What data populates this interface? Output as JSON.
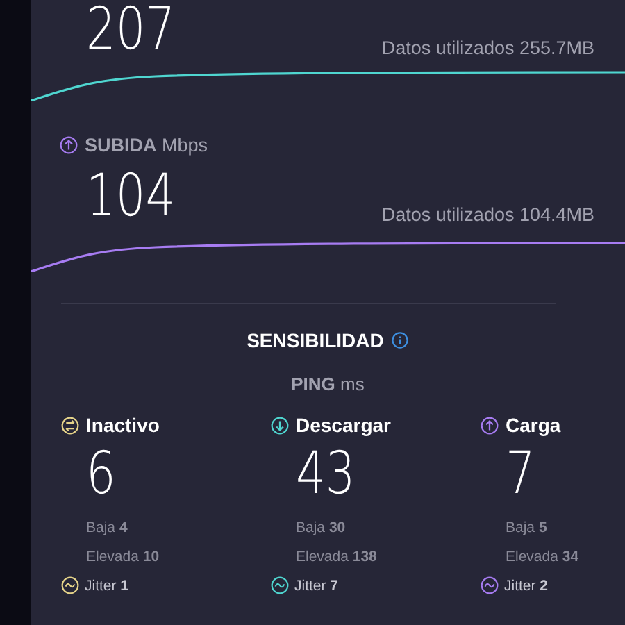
{
  "download": {
    "value": "207",
    "data_used": "Datos utilizados 255.7MB"
  },
  "upload": {
    "label": "**SUBIDA** Mbps",
    "value": "104",
    "data_used": "Datos utilizados 104.4MB"
  },
  "responsiveness": {
    "title": "SENSIBILIDAD",
    "ping": "**PING** ms",
    "columns": [
      {
        "kind": "idle",
        "color": "#e6d48a",
        "label": "Inactivo",
        "value": "6",
        "low": "Baja **4**",
        "high": "Elevada **10**",
        "jitter": "Jitter **1**"
      },
      {
        "kind": "download",
        "color": "#4fd6d0",
        "label": "Descargar",
        "value": "43",
        "low": "Baja **30**",
        "high": "Elevada **138**",
        "jitter": "Jitter **7**"
      },
      {
        "kind": "upload",
        "color": "#a77cf2",
        "label": "Carga",
        "value": "7",
        "low": "Baja **5**",
        "high": "Elevada **34**",
        "jitter": "Jitter **2**"
      }
    ]
  }
}
